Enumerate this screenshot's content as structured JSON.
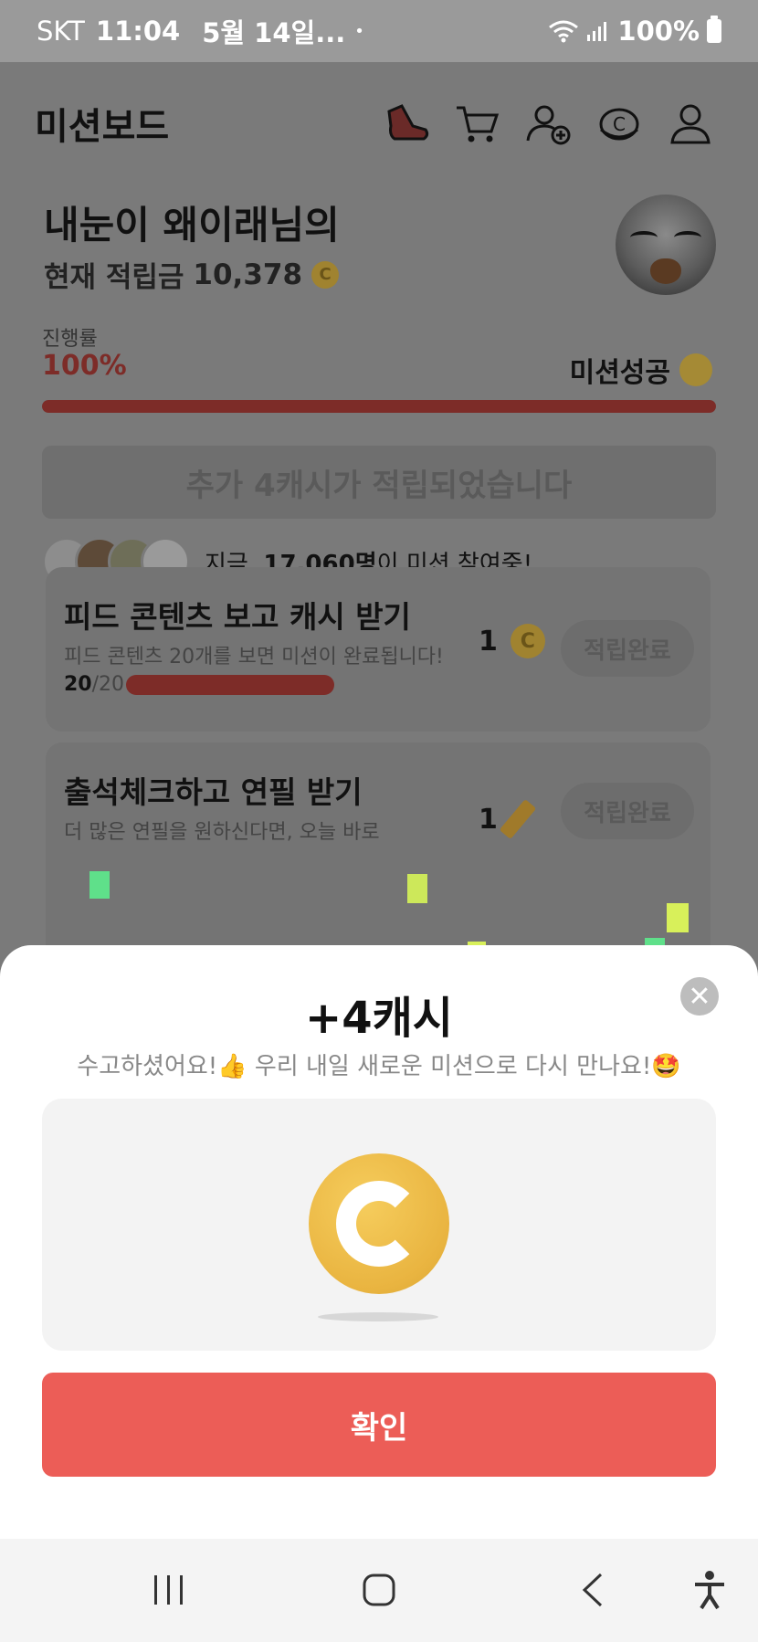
{
  "status_bar": {
    "carrier": "SKT",
    "time": "11:04",
    "date": "5월 14일...",
    "dot": "•",
    "battery_text": "100%"
  },
  "header": {
    "title": "미션보드",
    "icons": [
      "shoe-icon",
      "cart-icon",
      "add-friend-icon",
      "coin-shop-icon",
      "profile-icon"
    ]
  },
  "user": {
    "greeting": "내눈이 왜이래님의",
    "balance_label": "현재 적립금",
    "balance_value": "10,378",
    "coin_symbol": "C"
  },
  "progress": {
    "label": "진행률",
    "value_text": "100%",
    "fraction": 1.0,
    "success_text": "미션성공"
  },
  "extra_banner": "추가 4캐시가 적립되었습니다",
  "participants": {
    "text_prefix": "지금, ",
    "count_text": "17,060명",
    "text_suffix": "이 미션 참여중!"
  },
  "missions": [
    {
      "title": "피드 콘텐츠 보고 캐시 받기",
      "desc": "피드 콘텐츠 20개를 보면 미션이 완료됩니다!",
      "done": "20",
      "total": "/20",
      "reward": "1",
      "button": "적립완료"
    },
    {
      "title": "출석체크하고 연필 받기",
      "desc": "더 많은 연필을 원하신다면, 오늘 바로",
      "reward": "1",
      "button": "적립완료"
    }
  ],
  "sheet": {
    "title": "+4캐시",
    "message": "수고하셨어요!👍 우리 내일 새로운 미션으로 다시 만나요!🤩",
    "close_label": "✕",
    "confirm_label": "확인"
  },
  "colors": {
    "accent_red": "#ec5d57",
    "coin_gold": "#e9b440",
    "progress_red": "#7d2c28"
  }
}
